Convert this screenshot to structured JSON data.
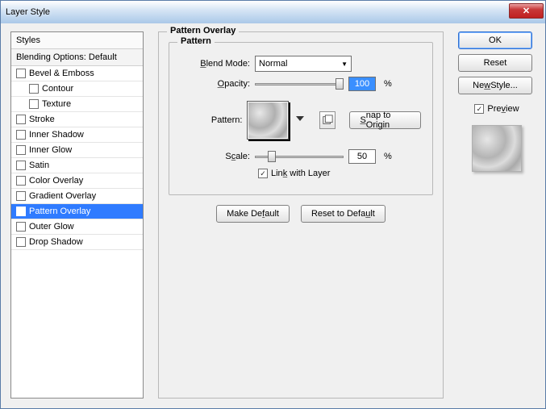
{
  "window": {
    "title": "Layer Style"
  },
  "left": {
    "header": "Styles",
    "subheader": "Blending Options: Default",
    "items": [
      {
        "label": "Bevel & Emboss",
        "checked": false,
        "indent": false
      },
      {
        "label": "Contour",
        "checked": false,
        "indent": true
      },
      {
        "label": "Texture",
        "checked": false,
        "indent": true
      },
      {
        "label": "Stroke",
        "checked": false,
        "indent": false
      },
      {
        "label": "Inner Shadow",
        "checked": false,
        "indent": false
      },
      {
        "label": "Inner Glow",
        "checked": false,
        "indent": false
      },
      {
        "label": "Satin",
        "checked": false,
        "indent": false
      },
      {
        "label": "Color Overlay",
        "checked": false,
        "indent": false
      },
      {
        "label": "Gradient Overlay",
        "checked": false,
        "indent": false
      },
      {
        "label": "Pattern Overlay",
        "checked": true,
        "indent": false,
        "selected": true
      },
      {
        "label": "Outer Glow",
        "checked": false,
        "indent": false
      },
      {
        "label": "Drop Shadow",
        "checked": false,
        "indent": false
      }
    ]
  },
  "center": {
    "heading": "Pattern Overlay",
    "group_legend": "Pattern",
    "blend_mode_label": "Blend Mode:",
    "blend_mode_value": "Normal",
    "opacity_label": "Opacity:",
    "opacity_value": "100",
    "opacity_unit": "%",
    "pattern_label": "Pattern:",
    "snap_label": "Snap to Origin",
    "scale_label": "Scale:",
    "scale_value": "50",
    "scale_unit": "%",
    "link_label": "Link with Layer",
    "link_checked": true,
    "make_default": "Make Default",
    "reset_default": "Reset to Default"
  },
  "right": {
    "ok": "OK",
    "reset": "Reset",
    "new_style": "New Style...",
    "preview_label": "Preview",
    "preview_checked": true
  }
}
